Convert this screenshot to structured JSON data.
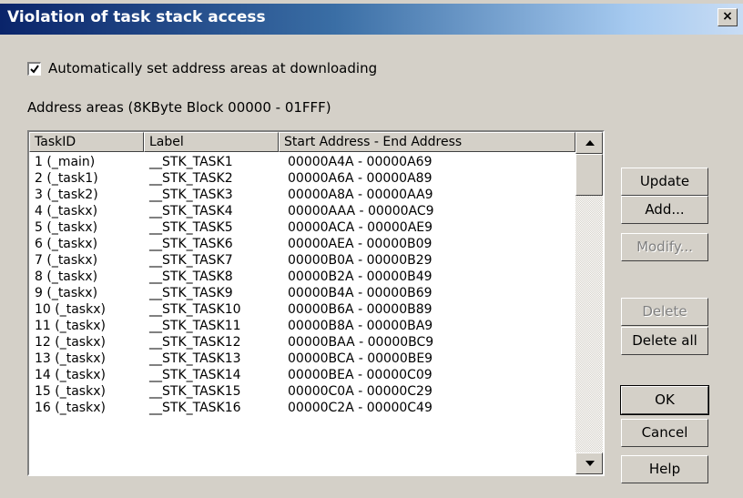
{
  "window": {
    "title": "Violation of task stack access"
  },
  "title_bar": {
    "close_label": "×"
  },
  "options": {
    "auto_set_label": "Automatically set address areas at downloading",
    "auto_set_checked": true
  },
  "address_areas_label": "Address areas (8KByte Block  00000 - 01FFF)",
  "table": {
    "columns": [
      "TaskID",
      "Label",
      "Start Address - End Address"
    ],
    "rows": [
      [
        "1 (_main)",
        "__STK_TASK1",
        "00000A4A - 00000A69"
      ],
      [
        "2 (_task1)",
        "__STK_TASK2",
        "00000A6A - 00000A89"
      ],
      [
        "3 (_task2)",
        "__STK_TASK3",
        "00000A8A - 00000AA9"
      ],
      [
        "4 (_taskx)",
        "__STK_TASK4",
        "00000AAA - 00000AC9"
      ],
      [
        "5 (_taskx)",
        "__STK_TASK5",
        "00000ACA - 00000AE9"
      ],
      [
        "6 (_taskx)",
        "__STK_TASK6",
        "00000AEA - 00000B09"
      ],
      [
        "7 (_taskx)",
        "__STK_TASK7",
        "00000B0A - 00000B29"
      ],
      [
        "8 (_taskx)",
        "__STK_TASK8",
        "00000B2A - 00000B49"
      ],
      [
        "9 (_taskx)",
        "__STK_TASK9",
        "00000B4A - 00000B69"
      ],
      [
        "10 (_taskx)",
        "__STK_TASK10",
        "00000B6A - 00000B89"
      ],
      [
        "11 (_taskx)",
        "__STK_TASK11",
        "00000B8A - 00000BA9"
      ],
      [
        "12 (_taskx)",
        "__STK_TASK12",
        "00000BAA - 00000BC9"
      ],
      [
        "13 (_taskx)",
        "__STK_TASK13",
        "00000BCA - 00000BE9"
      ],
      [
        "14 (_taskx)",
        "__STK_TASK14",
        "00000BEA - 00000C09"
      ],
      [
        "15 (_taskx)",
        "__STK_TASK15",
        "00000C0A - 00000C29"
      ],
      [
        "16 (_taskx)",
        "__STK_TASK16",
        "00000C2A - 00000C49"
      ]
    ]
  },
  "buttons": {
    "update": "Update",
    "add": "Add...",
    "modify": "Modify...",
    "delete": "Delete",
    "delete_all": "Delete all",
    "ok": "OK",
    "cancel": "Cancel",
    "help": "Help"
  },
  "colors": {
    "title_start": "#0a246a",
    "title_end": "#a6caf0",
    "face": "#d4d0c8"
  }
}
